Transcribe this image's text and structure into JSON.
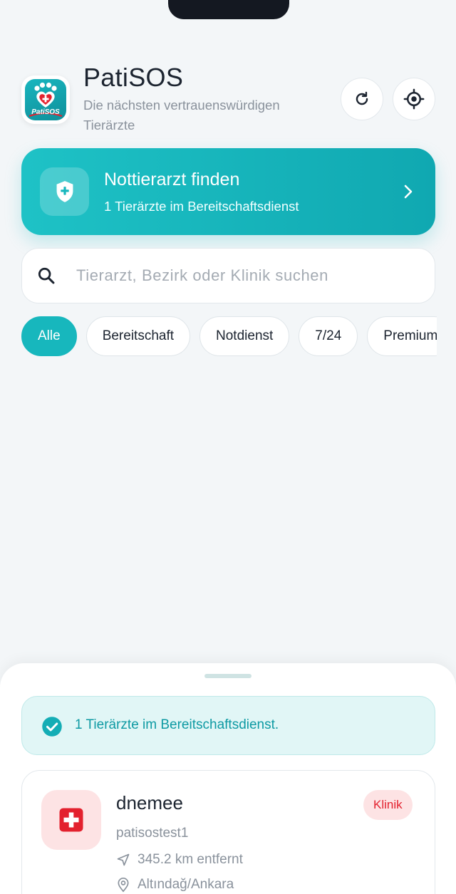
{
  "app": {
    "title": "PatiSOS",
    "subtitle": "Die nächsten vertrauenswürdigen Tierärzte",
    "logo_text": "PatiSOS"
  },
  "header": {
    "refresh_icon": "refresh-icon",
    "locate_icon": "crosshair-icon"
  },
  "emergency": {
    "title": "Nottierarzt finden",
    "subtitle": "1 Tierärzte im Bereitschaftsdienst",
    "icon": "shield-plus-icon"
  },
  "search": {
    "placeholder": "Tierarzt, Bezirk oder Klinik suchen",
    "value": ""
  },
  "filters": [
    {
      "label": "Alle",
      "active": true
    },
    {
      "label": "Bereitschaft",
      "active": false
    },
    {
      "label": "Notdienst",
      "active": false
    },
    {
      "label": "7/24",
      "active": false
    },
    {
      "label": "Premium",
      "active": false
    }
  ],
  "sheet": {
    "banner_text": "1 Tierärzte im Bereitschaftsdienst.",
    "clinics": [
      {
        "name": "dnemee",
        "owner": "patisostest1",
        "type": "Klinik",
        "distance": "345.2 km entfernt",
        "location": "Altındağ/Ankara"
      }
    ]
  },
  "colors": {
    "accent": "#17b7bd",
    "background": "#f3f6f8",
    "danger": "#e3212e",
    "danger_soft": "#fde3e4"
  }
}
